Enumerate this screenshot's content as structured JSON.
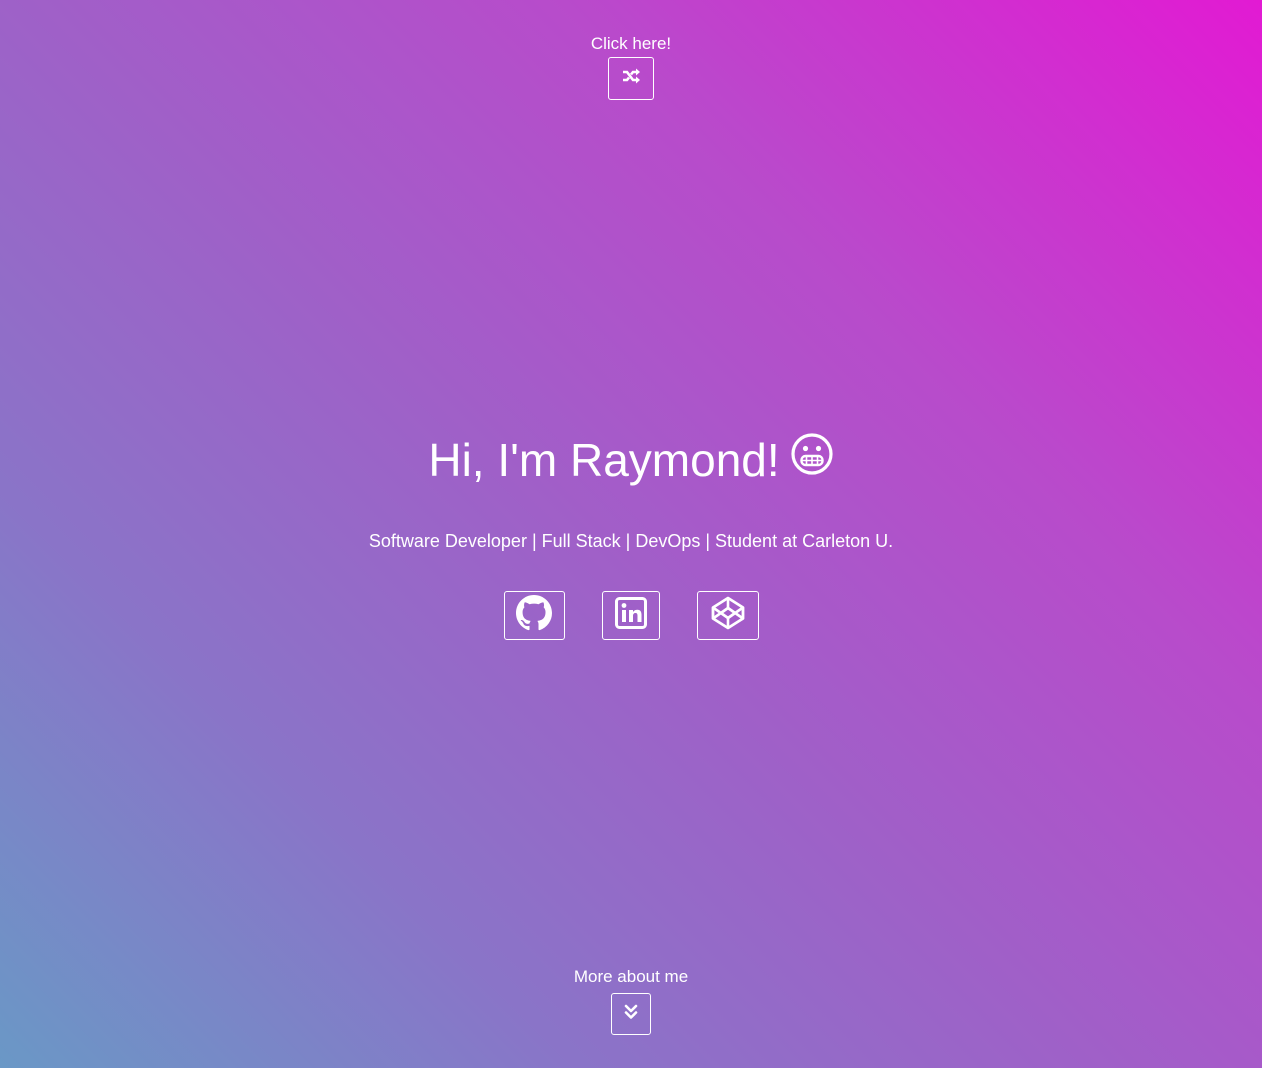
{
  "top": {
    "label": "Click here!",
    "button_icon": "shuffle-icon"
  },
  "hero": {
    "title": "Hi, I'm Raymond!",
    "emoji_icon": "grimace-face-icon",
    "subtitle": "Software Developer | Full Stack | DevOps | Student at Carleton U."
  },
  "social": [
    {
      "icon": "github-icon"
    },
    {
      "icon": "linkedin-icon"
    },
    {
      "icon": "codepen-icon"
    }
  ],
  "bottom": {
    "label": "More about me",
    "button_icon": "double-chevron-down-icon"
  },
  "colors": {
    "gradient_start": "#e21ad3",
    "gradient_end": "#6a98c6",
    "foreground": "#ffffff"
  }
}
